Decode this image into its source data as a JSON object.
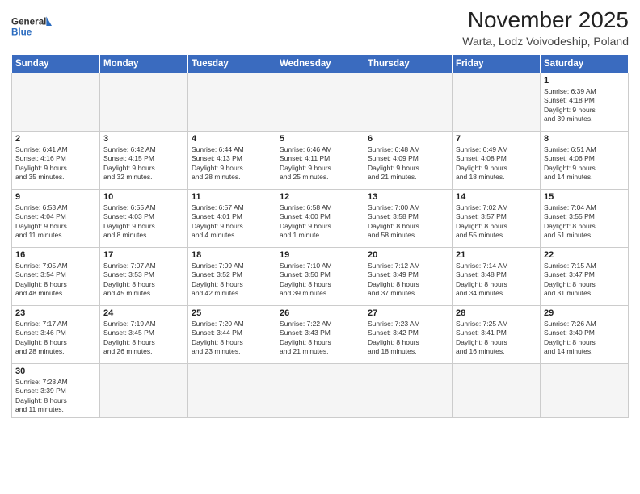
{
  "header": {
    "logo_general": "General",
    "logo_blue": "Blue",
    "month": "November 2025",
    "location": "Warta, Lodz Voivodeship, Poland"
  },
  "weekdays": [
    "Sunday",
    "Monday",
    "Tuesday",
    "Wednesday",
    "Thursday",
    "Friday",
    "Saturday"
  ],
  "weeks": [
    [
      {
        "day": "",
        "info": ""
      },
      {
        "day": "",
        "info": ""
      },
      {
        "day": "",
        "info": ""
      },
      {
        "day": "",
        "info": ""
      },
      {
        "day": "",
        "info": ""
      },
      {
        "day": "",
        "info": ""
      },
      {
        "day": "1",
        "info": "Sunrise: 6:39 AM\nSunset: 4:18 PM\nDaylight: 9 hours\nand 39 minutes."
      }
    ],
    [
      {
        "day": "2",
        "info": "Sunrise: 6:41 AM\nSunset: 4:16 PM\nDaylight: 9 hours\nand 35 minutes."
      },
      {
        "day": "3",
        "info": "Sunrise: 6:42 AM\nSunset: 4:15 PM\nDaylight: 9 hours\nand 32 minutes."
      },
      {
        "day": "4",
        "info": "Sunrise: 6:44 AM\nSunset: 4:13 PM\nDaylight: 9 hours\nand 28 minutes."
      },
      {
        "day": "5",
        "info": "Sunrise: 6:46 AM\nSunset: 4:11 PM\nDaylight: 9 hours\nand 25 minutes."
      },
      {
        "day": "6",
        "info": "Sunrise: 6:48 AM\nSunset: 4:09 PM\nDaylight: 9 hours\nand 21 minutes."
      },
      {
        "day": "7",
        "info": "Sunrise: 6:49 AM\nSunset: 4:08 PM\nDaylight: 9 hours\nand 18 minutes."
      },
      {
        "day": "8",
        "info": "Sunrise: 6:51 AM\nSunset: 4:06 PM\nDaylight: 9 hours\nand 14 minutes."
      }
    ],
    [
      {
        "day": "9",
        "info": "Sunrise: 6:53 AM\nSunset: 4:04 PM\nDaylight: 9 hours\nand 11 minutes."
      },
      {
        "day": "10",
        "info": "Sunrise: 6:55 AM\nSunset: 4:03 PM\nDaylight: 9 hours\nand 8 minutes."
      },
      {
        "day": "11",
        "info": "Sunrise: 6:57 AM\nSunset: 4:01 PM\nDaylight: 9 hours\nand 4 minutes."
      },
      {
        "day": "12",
        "info": "Sunrise: 6:58 AM\nSunset: 4:00 PM\nDaylight: 9 hours\nand 1 minute."
      },
      {
        "day": "13",
        "info": "Sunrise: 7:00 AM\nSunset: 3:58 PM\nDaylight: 8 hours\nand 58 minutes."
      },
      {
        "day": "14",
        "info": "Sunrise: 7:02 AM\nSunset: 3:57 PM\nDaylight: 8 hours\nand 55 minutes."
      },
      {
        "day": "15",
        "info": "Sunrise: 7:04 AM\nSunset: 3:55 PM\nDaylight: 8 hours\nand 51 minutes."
      }
    ],
    [
      {
        "day": "16",
        "info": "Sunrise: 7:05 AM\nSunset: 3:54 PM\nDaylight: 8 hours\nand 48 minutes."
      },
      {
        "day": "17",
        "info": "Sunrise: 7:07 AM\nSunset: 3:53 PM\nDaylight: 8 hours\nand 45 minutes."
      },
      {
        "day": "18",
        "info": "Sunrise: 7:09 AM\nSunset: 3:52 PM\nDaylight: 8 hours\nand 42 minutes."
      },
      {
        "day": "19",
        "info": "Sunrise: 7:10 AM\nSunset: 3:50 PM\nDaylight: 8 hours\nand 39 minutes."
      },
      {
        "day": "20",
        "info": "Sunrise: 7:12 AM\nSunset: 3:49 PM\nDaylight: 8 hours\nand 37 minutes."
      },
      {
        "day": "21",
        "info": "Sunrise: 7:14 AM\nSunset: 3:48 PM\nDaylight: 8 hours\nand 34 minutes."
      },
      {
        "day": "22",
        "info": "Sunrise: 7:15 AM\nSunset: 3:47 PM\nDaylight: 8 hours\nand 31 minutes."
      }
    ],
    [
      {
        "day": "23",
        "info": "Sunrise: 7:17 AM\nSunset: 3:46 PM\nDaylight: 8 hours\nand 28 minutes."
      },
      {
        "day": "24",
        "info": "Sunrise: 7:19 AM\nSunset: 3:45 PM\nDaylight: 8 hours\nand 26 minutes."
      },
      {
        "day": "25",
        "info": "Sunrise: 7:20 AM\nSunset: 3:44 PM\nDaylight: 8 hours\nand 23 minutes."
      },
      {
        "day": "26",
        "info": "Sunrise: 7:22 AM\nSunset: 3:43 PM\nDaylight: 8 hours\nand 21 minutes."
      },
      {
        "day": "27",
        "info": "Sunrise: 7:23 AM\nSunset: 3:42 PM\nDaylight: 8 hours\nand 18 minutes."
      },
      {
        "day": "28",
        "info": "Sunrise: 7:25 AM\nSunset: 3:41 PM\nDaylight: 8 hours\nand 16 minutes."
      },
      {
        "day": "29",
        "info": "Sunrise: 7:26 AM\nSunset: 3:40 PM\nDaylight: 8 hours\nand 14 minutes."
      }
    ],
    [
      {
        "day": "30",
        "info": "Sunrise: 7:28 AM\nSunset: 3:39 PM\nDaylight: 8 hours\nand 11 minutes."
      },
      {
        "day": "",
        "info": ""
      },
      {
        "day": "",
        "info": ""
      },
      {
        "day": "",
        "info": ""
      },
      {
        "day": "",
        "info": ""
      },
      {
        "day": "",
        "info": ""
      },
      {
        "day": "",
        "info": ""
      }
    ]
  ]
}
